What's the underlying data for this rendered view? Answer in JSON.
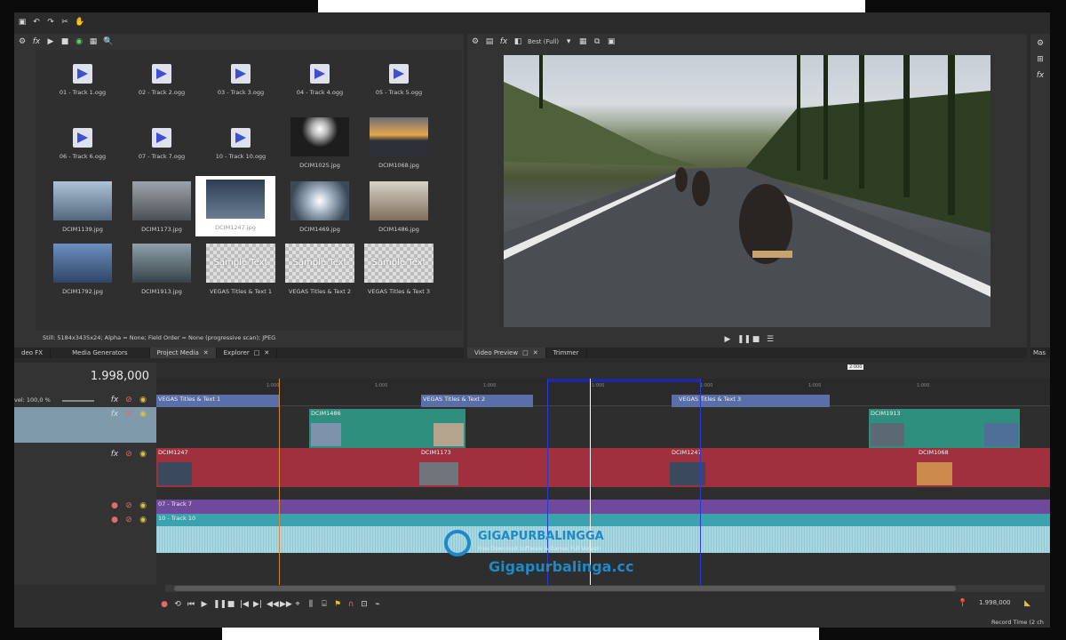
{
  "toolbar_main": {
    "icons": [
      "save-icon",
      "undo-icon",
      "redo-icon",
      "cut-icon",
      "paste-icon"
    ]
  },
  "media_panel": {
    "toolbar_icons": [
      "settings-icon",
      "fx-icon",
      "play-icon",
      "stop-icon",
      "autopreview-icon",
      "view-icon",
      "zoom-icon"
    ],
    "items": [
      {
        "label": "01 - Track 1.ogg",
        "kind": "audio"
      },
      {
        "label": "02 - Track 2.ogg",
        "kind": "audio"
      },
      {
        "label": "03 - Track 3.ogg",
        "kind": "audio"
      },
      {
        "label": "04 - Track 4.ogg",
        "kind": "audio"
      },
      {
        "label": "05 - Track 5.ogg",
        "kind": "audio"
      },
      {
        "label": "06 - Track 6.ogg",
        "kind": "audio"
      },
      {
        "label": "07 - Track 7.ogg",
        "kind": "audio"
      },
      {
        "label": "10 - Track 10.ogg",
        "kind": "audio"
      },
      {
        "label": "DCIM1025.jpg",
        "kind": "image",
        "color": "#2b2b2b"
      },
      {
        "label": "DCIM1068.jpg",
        "kind": "image",
        "color": "#c98a4b"
      },
      {
        "label": "DCIM1139.jpg",
        "kind": "image",
        "color": "#7a93ac"
      },
      {
        "label": "DCIM1173.jpg",
        "kind": "image",
        "color": "#6f747a"
      },
      {
        "label": "DCIM1247.jpg",
        "kind": "image",
        "color": "#3a4a5c"
      },
      {
        "label": "DCIM1469.jpg",
        "kind": "image",
        "color": "#8fa4b8"
      },
      {
        "label": "DCIM1486.jpg",
        "kind": "image",
        "color": "#b9aa96"
      },
      {
        "label": "DCIM1792.jpg",
        "kind": "image",
        "color": "#4f6f98"
      },
      {
        "label": "DCIM1913.jpg",
        "kind": "image",
        "color": "#5b6a72"
      },
      {
        "label": "VEGAS Titles & Text 1",
        "kind": "sample"
      },
      {
        "label": "VEGAS Titles & Text 2",
        "kind": "sample"
      },
      {
        "label": "VEGAS Titles & Text 3",
        "kind": "sample"
      }
    ],
    "sample_text": "Sample Text",
    "status": "Still: 5184x3435x24; Alpha = None; Field Order = None (progressive scan); JPEG",
    "tabs": [
      "deo FX",
      "Media Generators",
      "Project Media",
      "Explorer"
    ]
  },
  "preview": {
    "quality": "Best (Full)",
    "tabs": [
      "Video Preview",
      "Trimmer"
    ],
    "controls": [
      "play-icon",
      "pause-icon",
      "stop-icon",
      "menu-icon"
    ]
  },
  "right_strip": {
    "label": "Mas"
  },
  "timeline": {
    "timecode": "1.998,000",
    "level": "vel: 100,0 %",
    "marker_label": "2:000",
    "ruler": [
      "1:000",
      "1:000",
      "1:000",
      "1:000",
      "1:000",
      "1:000",
      "1:000"
    ],
    "clips": {
      "titles": [
        "VEGAS Titles & Text 1",
        "VEGAS Titles & Text 2",
        "VEGAS Titles & Text 3"
      ],
      "track2": [
        "DCIM1486",
        "DCIM1913"
      ],
      "track3": [
        "DCIM1247",
        "DCIM1173",
        "DCIM1247",
        "DCIM1068"
      ],
      "audio": [
        "07 - Track 7",
        "10 - Track 10"
      ]
    },
    "end_time": "1.998,000",
    "record_time": "Record Time (2 ch"
  },
  "watermark": {
    "brand": "GIGAPURBALINGGA",
    "tagline": "Free Download Software & Games Full Version",
    "url": "Gigapurbalinga.cc"
  },
  "colors": {
    "title_clip": "#5a6fa8",
    "video_green": "#2e8f7e",
    "video_red": "#a0303e",
    "audio_purple": "#6f4a9c",
    "audio_teal": "#3aa3ad"
  }
}
